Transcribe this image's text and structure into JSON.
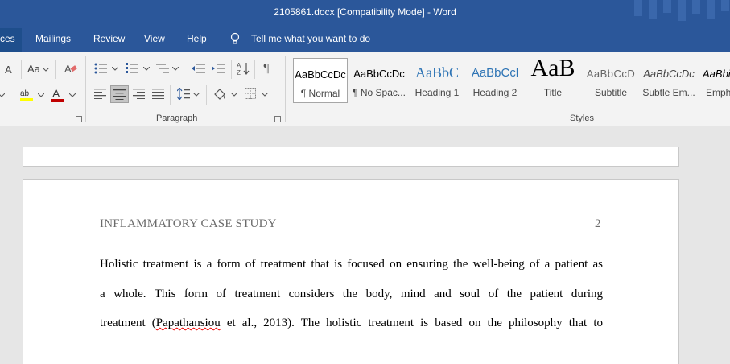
{
  "window": {
    "title": "2105861.docx [Compatibility Mode]  -  Word"
  },
  "menu": {
    "tabs": [
      "ces",
      "Mailings",
      "Review",
      "View",
      "Help"
    ],
    "tell_me": "Tell me what you want to do"
  },
  "ribbon": {
    "font": {
      "change_case": "Aa",
      "grow_partial": "A"
    },
    "paragraph_label": "Paragraph",
    "styles_label": "Styles",
    "styles": [
      {
        "preview": "AaBbCcDc",
        "name": "¶ Normal"
      },
      {
        "preview": "AaBbCcDc",
        "name": "¶ No Spac..."
      },
      {
        "preview": "AaBbC",
        "name": "Heading 1"
      },
      {
        "preview": "AaBbCcl",
        "name": "Heading 2"
      },
      {
        "preview": "AaB",
        "name": "Title"
      },
      {
        "preview": "AaBbCcD",
        "name": "Subtitle"
      },
      {
        "preview": "AaBbCcDc",
        "name": "Subtle Em..."
      },
      {
        "preview": "AaBbi",
        "name": "Emph"
      }
    ],
    "colors": {
      "highlight": "#ffff00",
      "font_color": "#c00000"
    }
  },
  "document": {
    "header_text": "INFLAMMATORY CASE STUDY",
    "page_number": "2",
    "lines": [
      "Holistic treatment is a form of treatment that is focused on ensuring the well-being of a patient as",
      "a whole. This form of treatment considers the body, mind and soul of the patient during"
    ],
    "line3_before": "treatment (",
    "line3_misspelled": "Papathansiou",
    "line3_after": " et al., 2013). The holistic treatment is based on the philosophy that to"
  },
  "colors": {
    "accent": "#2b579a",
    "ribbon_bg": "#f3f3f3",
    "canvas_bg": "#e6e6e6"
  }
}
